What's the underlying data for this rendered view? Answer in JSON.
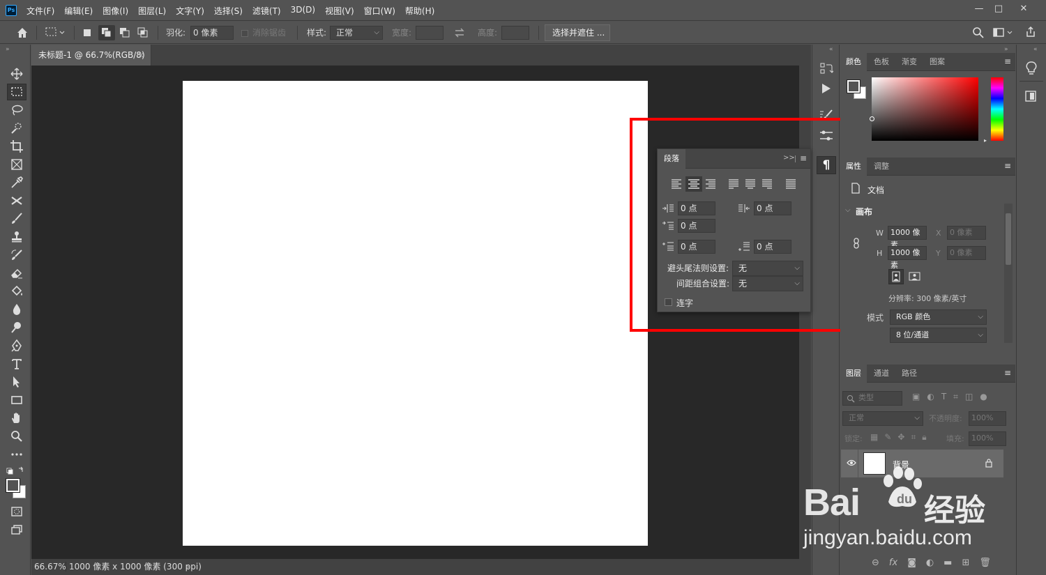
{
  "app": {
    "logo": "Ps"
  },
  "menu": [
    "文件(F)",
    "编辑(E)",
    "图像(I)",
    "图层(L)",
    "文字(Y)",
    "选择(S)",
    "滤镜(T)",
    "3D(D)",
    "视图(V)",
    "窗口(W)",
    "帮助(H)"
  ],
  "window_controls": {
    "minimize": "—",
    "maximize": "□",
    "close": "✕"
  },
  "options_bar": {
    "feather_label": "羽化:",
    "feather_value": "0 像素",
    "antialias_label": "消除锯齿",
    "style_label": "样式:",
    "style_value": "正常",
    "width_label": "宽度:",
    "height_label": "高度:",
    "select_mask_button": "选择并遮住 ..."
  },
  "document": {
    "tab_title": "未标题-1 @ 66.7%(RGB/8)",
    "tab_close": "×",
    "zoom": "66.67%",
    "size_info": "1000 像素 x 1000 像素 (300 ppi)",
    "status_arrow": "›"
  },
  "paragraph_panel": {
    "title": "段落",
    "collapse": ">>",
    "fields": {
      "indent_left": "0 点",
      "indent_right": "0 点",
      "indent_first": "0 点",
      "space_before": "0 点",
      "space_after": "0 点"
    },
    "kinsoku_label": "避头尾法则设置:",
    "kinsoku_value": "无",
    "mojikumi_label": "间距组合设置:",
    "mojikumi_value": "无",
    "hyphenate_label": "连字"
  },
  "color_panel": {
    "tabs": [
      "颜色",
      "色板",
      "渐变",
      "图案"
    ]
  },
  "properties_panel": {
    "tabs": [
      "属性",
      "调整"
    ],
    "doc_label": "文档",
    "canvas_section": "画布",
    "w_label": "W",
    "w_value": "1000 像素",
    "h_label": "H",
    "h_value": "1000 像素",
    "x_label": "X",
    "x_value": "0 像素",
    "y_label": "Y",
    "y_value": "0 像素",
    "resolution": "分辨率: 300 像素/英寸",
    "mode_label": "模式",
    "mode_value": "RGB 颜色",
    "depth_value": "8 位/通道"
  },
  "layers_panel": {
    "tabs": [
      "图层",
      "通道",
      "路径"
    ],
    "filter_placeholder": "类型",
    "blend_mode": "正常",
    "opacity_label": "不透明度:",
    "opacity_value": "100%",
    "lock_label": "锁定:",
    "fill_label": "填充:",
    "fill_value": "100%",
    "layer_name": "背景"
  },
  "watermark": {
    "brand": "Bai",
    "brand2": "经验",
    "url": "jingyan.baidu.com"
  },
  "colors": {
    "accent_red": "#ff0000",
    "ps_blue": "#31a8ff"
  }
}
